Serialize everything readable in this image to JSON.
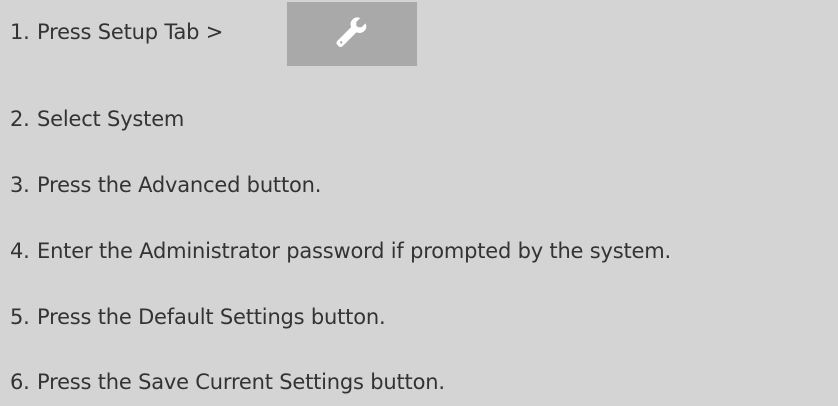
{
  "steps": [
    {
      "number": "1.",
      "text": "Press Setup Tab >"
    },
    {
      "number": "2.",
      "text": "Select System"
    },
    {
      "number": "3.",
      "text": "Press the Advanced button."
    },
    {
      "number": "4.",
      "text": "Enter the Administrator password if prompted by the system."
    },
    {
      "number": "5.",
      "text": "Press the Default Settings button."
    },
    {
      "number": "6.",
      "text": "Press the Save Current Settings button."
    }
  ],
  "setup_tab": {
    "icon": "wrench-icon",
    "background_color": "#a9a9a9",
    "icon_color": "#ffffff"
  },
  "colors": {
    "page_background": "#d4d4d4",
    "text": "#333333"
  }
}
